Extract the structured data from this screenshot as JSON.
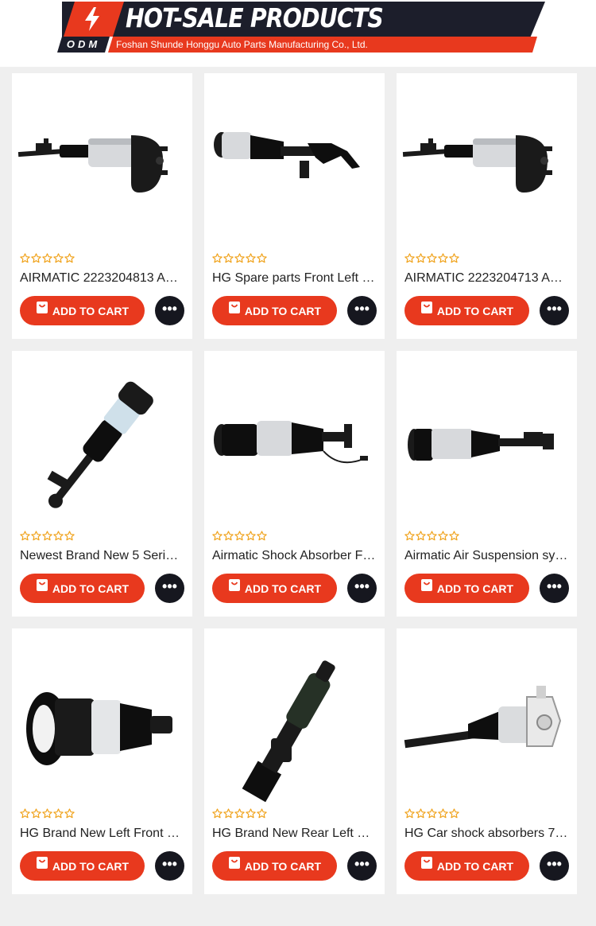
{
  "banner": {
    "title": "HOT-SALE PRODUCTS",
    "tag": "ODM",
    "company": "Foshan Shunde Honggu Auto Parts Manufacturing Co., Ltd."
  },
  "colors": {
    "accent": "#e8391e",
    "dark": "#1c1e2b",
    "star": "#f0a21a"
  },
  "products": [
    {
      "title": "AIRMATIC 2223204813 A…",
      "add_label": "ADD TO CART",
      "more_label": "•••",
      "rating": 0,
      "image": "air-strut-horizontal"
    },
    {
      "title": "HG Spare parts Front Left …",
      "add_label": "ADD TO CART",
      "more_label": "•••",
      "rating": 0,
      "image": "air-strut-with-fork"
    },
    {
      "title": "AIRMATIC 2223204713 A…",
      "add_label": "ADD TO CART",
      "more_label": "•••",
      "rating": 0,
      "image": "air-strut-horizontal"
    },
    {
      "title": "Newest Brand New 5 Seri…",
      "add_label": "ADD TO CART",
      "more_label": "•••",
      "rating": 0,
      "image": "air-strut-diagonal"
    },
    {
      "title": "Airmatic Shock Absorber F…",
      "add_label": "ADD TO CART",
      "more_label": "•••",
      "rating": 0,
      "image": "air-strut-with-wire"
    },
    {
      "title": "Airmatic Air Suspension sy…",
      "add_label": "ADD TO CART",
      "more_label": "•••",
      "rating": 0,
      "image": "air-strut-long"
    },
    {
      "title": "HG Brand New Left Front …",
      "add_label": "ADD TO CART",
      "more_label": "•••",
      "rating": 0,
      "image": "air-spring-top-mount"
    },
    {
      "title": "HG Brand New Rear Left …",
      "add_label": "ADD TO CART",
      "more_label": "•••",
      "rating": 0,
      "image": "rear-shock-bellows"
    },
    {
      "title": "HG Car shock absorbers 7…",
      "add_label": "ADD TO CART",
      "more_label": "•••",
      "rating": 0,
      "image": "air-strut-knuckle"
    }
  ]
}
